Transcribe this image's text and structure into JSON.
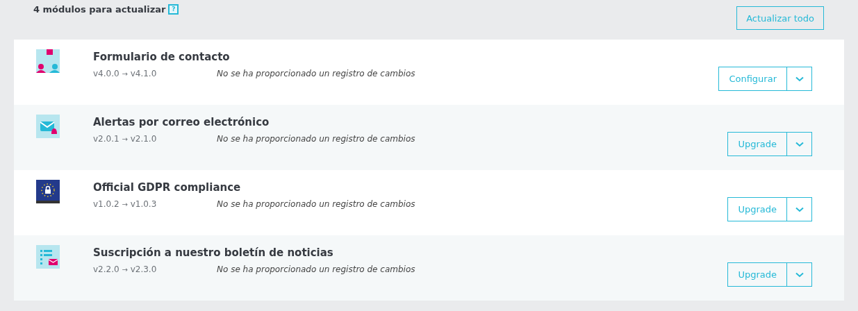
{
  "header": {
    "title": "4 módulos para actualizar",
    "help": "?",
    "update_all": "Actualizar todo"
  },
  "modules": [
    {
      "kind": "contact",
      "name": "Formulario de contacto",
      "from": "v4.0.0",
      "arrow": "→",
      "to": "v4.1.0",
      "changelog": "No se ha proporcionado un registro de cambios",
      "action": "Configurar"
    },
    {
      "kind": "mail-alert",
      "name": "Alertas por correo electrónico",
      "from": "v2.0.1",
      "arrow": "→",
      "to": "v2.1.0",
      "changelog": "No se ha proporcionado un registro de cambios",
      "action": "Upgrade"
    },
    {
      "kind": "gdpr",
      "name": "Official GDPR compliance",
      "from": "v1.0.2",
      "arrow": "→",
      "to": "v1.0.3",
      "changelog": "No se ha proporcionado un registro de cambios",
      "action": "Upgrade"
    },
    {
      "kind": "newsletter",
      "name": "Suscripción a nuestro boletín de noticias",
      "from": "v2.2.0",
      "arrow": "→",
      "to": "v2.3.0",
      "changelog": "No se ha proporcionado un registro de cambios",
      "action": "Upgrade"
    }
  ]
}
